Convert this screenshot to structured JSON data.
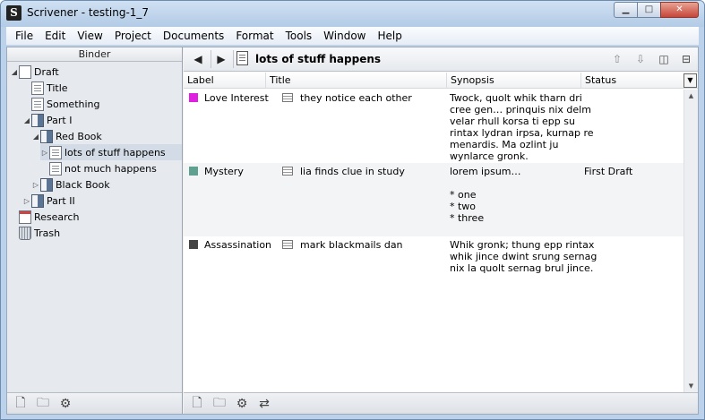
{
  "window": {
    "title": "Scrivener - testing-1_7",
    "app_icon_glyph": "S"
  },
  "window_controls": {
    "minimize": "▁",
    "maximize": "□",
    "close": "✕"
  },
  "menu": [
    "File",
    "Edit",
    "View",
    "Project",
    "Documents",
    "Format",
    "Tools",
    "Window",
    "Help"
  ],
  "binder": {
    "header": "Binder",
    "items": [
      {
        "label": "Draft",
        "icon": "draft-icon",
        "expander": "◢"
      },
      {
        "label": "Title",
        "icon": "document-icon",
        "expander": ""
      },
      {
        "label": "Something",
        "icon": "document-icon",
        "expander": ""
      },
      {
        "label": "Part I",
        "icon": "folder-icon",
        "expander": "◢"
      },
      {
        "label": "Red Book",
        "icon": "folder-icon",
        "expander": "◢"
      },
      {
        "label": "lots of stuff happens",
        "icon": "document-icon",
        "expander": "▷"
      },
      {
        "label": "not much happens",
        "icon": "document-icon",
        "expander": ""
      },
      {
        "label": "Black Book",
        "icon": "folder-icon",
        "expander": "▷"
      },
      {
        "label": "Part II",
        "icon": "folder-icon",
        "expander": "▷"
      },
      {
        "label": "Research",
        "icon": "research-icon",
        "expander": ""
      },
      {
        "label": "Trash",
        "icon": "trash-icon",
        "expander": ""
      }
    ],
    "footer_icons": [
      "new-document-icon",
      "new-folder-icon",
      "gear-icon"
    ]
  },
  "navbar": {
    "back": "◀",
    "forward": "▶",
    "title": "lots of stuff happens",
    "right_icons": [
      "up-arrow-icon",
      "down-arrow-icon",
      "split-vertical-icon",
      "split-horizontal-icon"
    ],
    "right_glyphs": [
      "⇧",
      "⇩",
      "◫",
      "⊟"
    ]
  },
  "outline": {
    "columns": [
      "Label",
      "Title",
      "Synopsis",
      "Status"
    ],
    "rows": [
      {
        "label": "Love Interest",
        "label_color": "#e020e0",
        "title": "they notice each other",
        "synopsis": "Twock, quolt whik tharn dri\ncree gen… prinquis nix delm\nvelar rhull korsa ti epp su\nrintax lydran irpsa, kurnap re\nmenardis. Ma ozlint ju\nwynlarce gronk.",
        "status": ""
      },
      {
        "label": "Mystery",
        "label_color": "#5fa090",
        "title": "lia finds clue in study",
        "synopsis": "lorem ipsum…\n\n* one\n* two\n* three",
        "status": "First Draft"
      },
      {
        "label": "Assassination",
        "label_color": "#444444",
        "title": "mark blackmails dan",
        "synopsis": "Whik gronk; thung epp rintax\nwhik jince dwint srung sernag\nnix la quolt sernag brul jince.",
        "status": ""
      }
    ]
  },
  "main_footer_icons": [
    "new-document-icon",
    "new-folder-icon",
    "gear-icon",
    "swap-icon"
  ],
  "footer_glyphs": {
    "new_document": "🗋",
    "new_folder": "🗀",
    "gear": "⚙",
    "swap": "⇄"
  }
}
